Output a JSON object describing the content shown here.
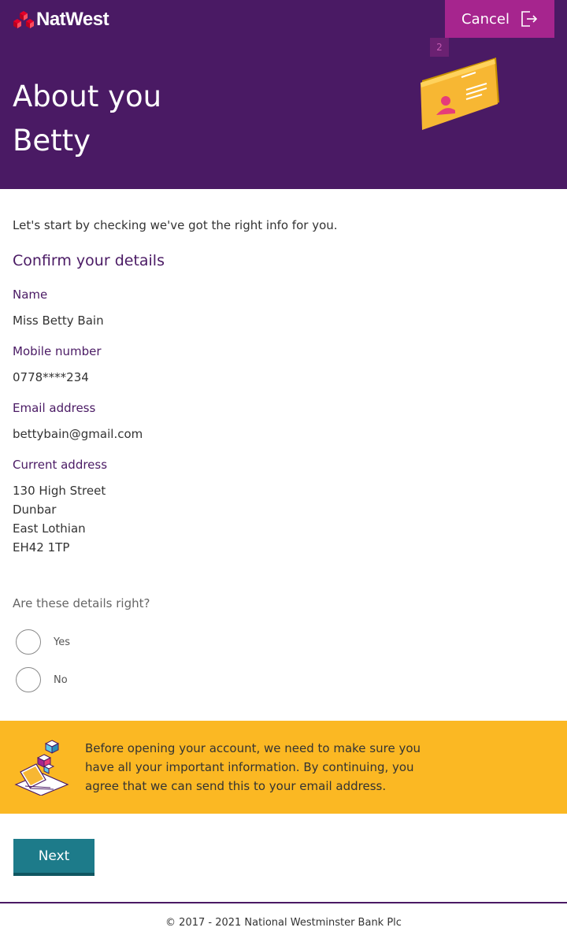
{
  "brand": {
    "name": "NatWest",
    "purple": "#4a1a64",
    "magenta": "#a6258e",
    "teal": "#1d7b8a",
    "yellow": "#fbb823"
  },
  "header": {
    "cancel_label": "Cancel",
    "step_number": "2",
    "title_line1": "About you",
    "title_line2": "Betty"
  },
  "main": {
    "intro": "Let's start by checking we've got the right info for you.",
    "section_title": "Confirm your details",
    "fields": [
      {
        "label": "Name",
        "value": "Miss Betty Bain"
      },
      {
        "label": "Mobile number",
        "value": "0778****234"
      },
      {
        "label": "Email address",
        "value": "bettybain@gmail.com"
      },
      {
        "label": "Current address",
        "lines": [
          "130 High Street",
          "Dunbar",
          "East Lothian",
          "EH42 1TP"
        ]
      }
    ],
    "question": "Are these details right?",
    "options": [
      {
        "label": "Yes",
        "selected": false
      },
      {
        "label": "No",
        "selected": false
      }
    ]
  },
  "notice": {
    "text": "Before opening your account, we need to make sure you have all your important information. By continuing, you agree that we can send this to your email address."
  },
  "actions": {
    "next_label": "Next"
  },
  "footer": {
    "copyright": "© 2017 - 2021 National Westminster Bank Plc"
  }
}
